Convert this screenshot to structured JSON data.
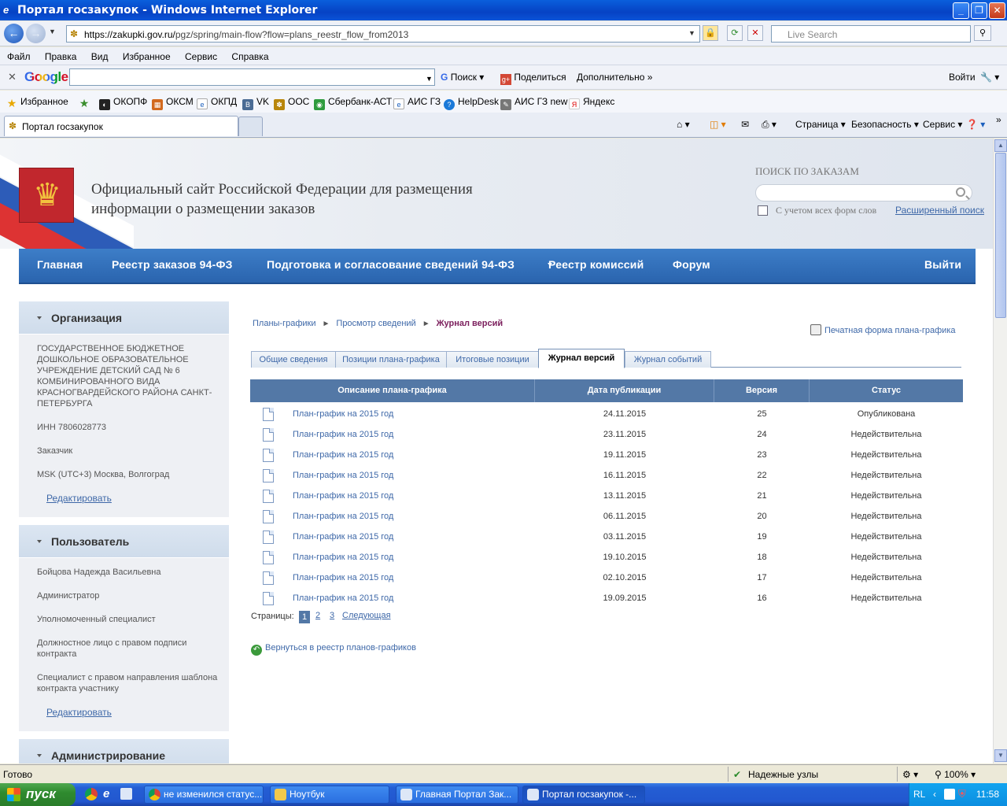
{
  "window": {
    "title": "Портал госзакупок - Windows Internet Explorer"
  },
  "address": {
    "url_host": "https://zakupki.gov.ru/",
    "url_path": "pgz/spring/main-flow?flow=plans_reestr_flow_from2013",
    "live_search_placeholder": "Live Search"
  },
  "menu": [
    "Файл",
    "Правка",
    "Вид",
    "Избранное",
    "Сервис",
    "Справка"
  ],
  "google_bar": {
    "logo": "Google",
    "search_label": "Поиск",
    "share_label": "Поделиться",
    "more_label": "Дополнительно",
    "login_label": "Войти"
  },
  "favorites": {
    "label": "Избранное",
    "items": [
      "ОКОПФ",
      "ОКСМ",
      "ОКПД",
      "VK",
      "ООС",
      "Сбербанк-АСТ",
      "АИС ГЗ",
      "HelpDesk",
      "АИС ГЗ new",
      "Яндекс"
    ]
  },
  "tabs_bar": {
    "active_tab": "Портал госзакупок",
    "tools": [
      "Страница",
      "Безопасность",
      "Сервис"
    ]
  },
  "site": {
    "title_line1": "Официальный сайт Российской Федерации для размещения",
    "title_line2": "информации о размещении заказов",
    "search_label": "ПОИСК ПО ЗАКАЗАМ",
    "search_checkbox_label": "С учетом всех форм слов",
    "advanced_search": "Расширенный поиск"
  },
  "nav": [
    "Главная",
    "Реестр заказов 94-ФЗ",
    "Подготовка и согласование сведений 94-ФЗ",
    "Реестр комиссий",
    "Форум",
    "Выйти"
  ],
  "sidebar": {
    "org": {
      "title": "Организация",
      "name": "ГОСУДАРСТВЕННОЕ БЮДЖЕТНОЕ ДОШКОЛЬНОЕ ОБРАЗОВАТЕЛЬНОЕ УЧРЕЖДЕНИЕ ДЕТСКИЙ САД № 6 КОМБИНИРОВАННОГО ВИДА КРАСНОГВАРДЕЙСКОГО РАЙОНА САНКТ-ПЕТЕРБУРГА",
      "inn": "ИНН 7806028773",
      "role": "Заказчик",
      "timezone": "MSK (UTC+3) Москва, Волгоград",
      "edit": "Редактировать"
    },
    "user": {
      "title": "Пользователь",
      "name": "Бойцова Надежда Васильевна",
      "roles": [
        "Администратор",
        "Уполномоченный специалист",
        "Должностное лицо с правом подписи контракта",
        "Специалист с правом направления шаблона контракта участнику"
      ],
      "edit": "Редактировать"
    },
    "admin": {
      "title": "Администрирование"
    }
  },
  "content": {
    "breadcrumbs": [
      "Планы-графики",
      "Просмотр сведений",
      "Журнал версий"
    ],
    "print_form": "Печатная форма плана-графика",
    "tabs": [
      "Общие сведения",
      "Позиции плана-графика",
      "Итоговые позиции",
      "Журнал версий",
      "Журнал событий"
    ],
    "table": {
      "headers": [
        "Описание плана-графика",
        "Дата публикации",
        "Версия",
        "Статус"
      ],
      "rows": [
        {
          "desc": "План-график на 2015 год",
          "date": "24.11.2015",
          "version": "25",
          "status": "Опубликована"
        },
        {
          "desc": "План-график на 2015 год",
          "date": "23.11.2015",
          "version": "24",
          "status": "Недействительна"
        },
        {
          "desc": "План-график на 2015 год",
          "date": "19.11.2015",
          "version": "23",
          "status": "Недействительна"
        },
        {
          "desc": "План-график на 2015 год",
          "date": "16.11.2015",
          "version": "22",
          "status": "Недействительна"
        },
        {
          "desc": "План-график на 2015 год",
          "date": "13.11.2015",
          "version": "21",
          "status": "Недействительна"
        },
        {
          "desc": "План-график на 2015 год",
          "date": "06.11.2015",
          "version": "20",
          "status": "Недействительна"
        },
        {
          "desc": "План-график на 2015 год",
          "date": "03.11.2015",
          "version": "19",
          "status": "Недействительна"
        },
        {
          "desc": "План-график на 2015 год",
          "date": "19.10.2015",
          "version": "18",
          "status": "Недействительна"
        },
        {
          "desc": "План-график на 2015 год",
          "date": "02.10.2015",
          "version": "17",
          "status": "Недействительна"
        },
        {
          "desc": "План-график на 2015 год",
          "date": "19.09.2015",
          "version": "16",
          "status": "Недействительна"
        }
      ]
    },
    "pager": {
      "label": "Страницы:",
      "pages": [
        "1",
        "2",
        "3"
      ],
      "next": "Следующая"
    },
    "back_link": "Вернуться в реестр планов-графиков"
  },
  "status_bar": {
    "status": "Готово",
    "zone": "Надежные узлы",
    "zoom": "100%"
  },
  "taskbar": {
    "start": "пуск",
    "tasks": [
      "не изменился статус...",
      "Ноутбук",
      "Главная Портал Зак...",
      "Портал госзакупок -..."
    ],
    "lang": "RL",
    "clock": "11:58"
  }
}
